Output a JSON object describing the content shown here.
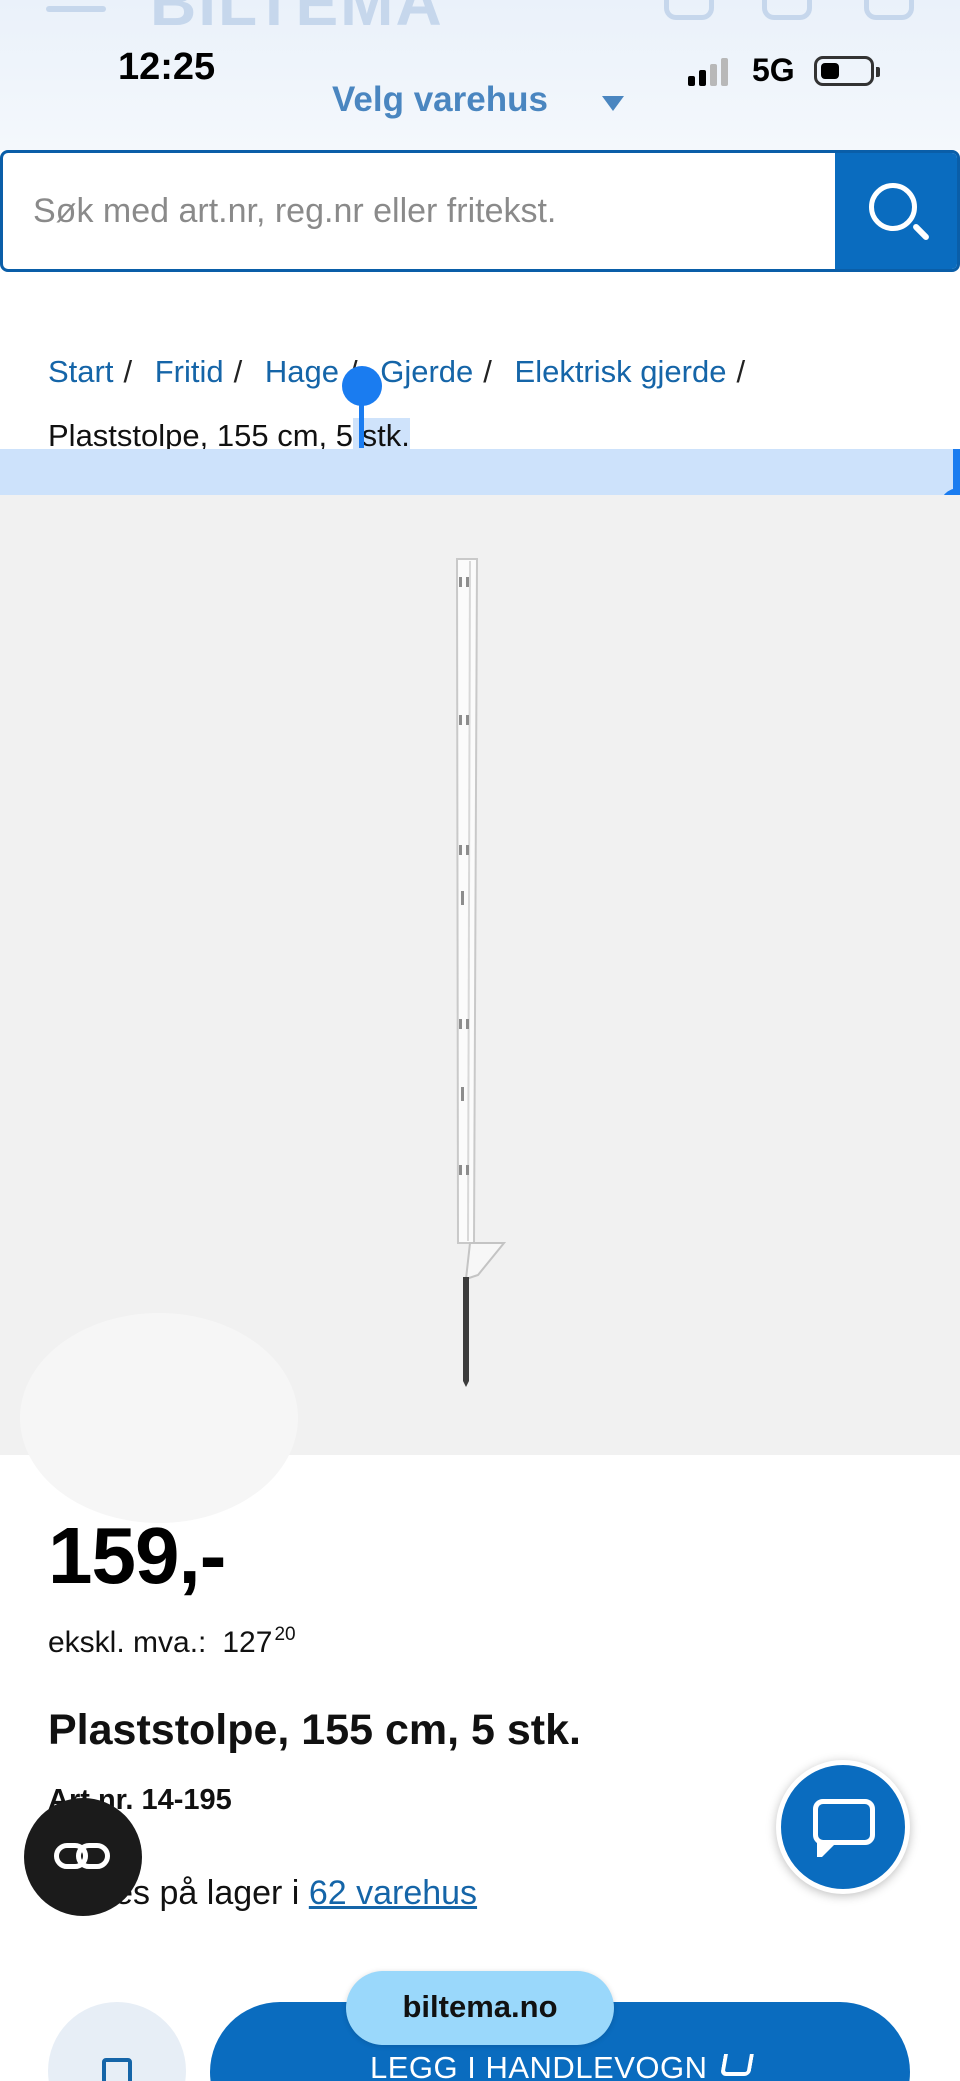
{
  "status_bar": {
    "time": "12:25",
    "network": "5G",
    "icons": [
      "signal-icon",
      "battery-icon"
    ]
  },
  "header": {
    "logo_text": "BILTEMA",
    "icons": [
      "hamburger-icon",
      "user-icon",
      "list-icon",
      "cart-icon"
    ],
    "store_select_label": "Velg varehus"
  },
  "search": {
    "placeholder": "Søk med art.nr, reg.nr eller fritekst.",
    "value": "",
    "button_icon": "search-icon"
  },
  "breadcrumb": {
    "items": [
      "Start",
      "Fritid",
      "Hage",
      "Gjerde",
      "Elektrisk gjerde"
    ],
    "separator": "/",
    "current_a": "Plaststolpe, 155 cm, 5",
    "current_b": " stk."
  },
  "product": {
    "image_alt_icon": "fence-post-icon",
    "price": "159,-",
    "ex_vat_label": "ekskl. mva.:",
    "ex_vat_main": "127",
    "ex_vat_cents": "20",
    "title": "Plaststolpe, 155 cm, 5 stk.",
    "art_nr": "Art.nr. 14-195",
    "stock_prefix": "Finnes på lager i",
    "stock_link": "62 varehus"
  },
  "actions": {
    "add_to_cart": "LEGG I HANDLEVOGN",
    "chat_icon": "chat-icon",
    "edit_icon": "edit-icon",
    "cobrowse_icon": "cobrowse-icon"
  },
  "browser": {
    "url": "biltema.no"
  },
  "colors": {
    "brand_blue": "#0a6cbf",
    "link_blue": "#1565a8",
    "selection": "#cfe3fb"
  }
}
